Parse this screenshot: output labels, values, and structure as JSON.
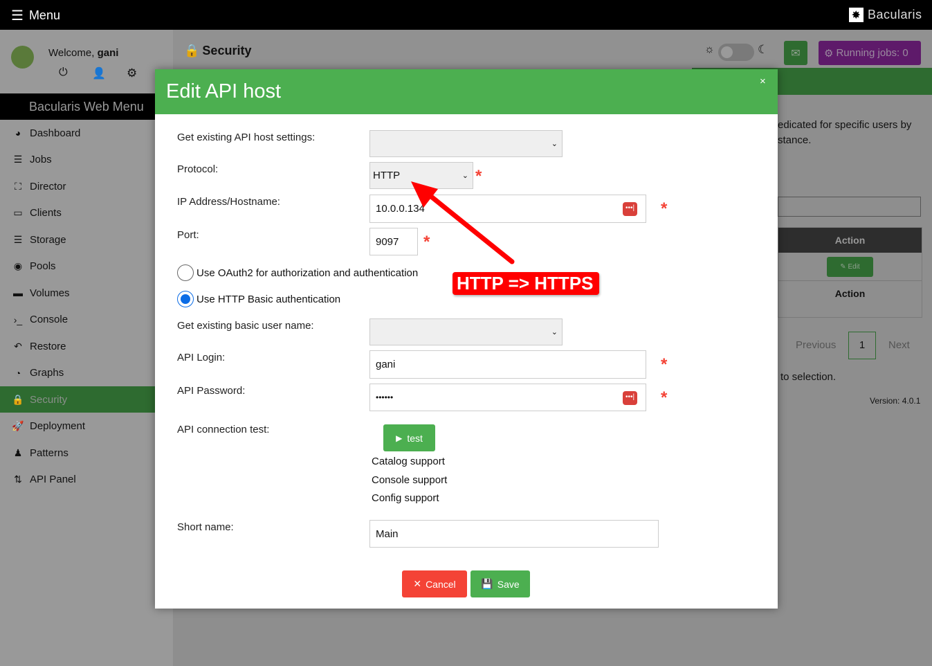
{
  "topbar": {
    "menu_label": "Menu",
    "brand": "Bacularis"
  },
  "user": {
    "welcome": "Welcome,",
    "name": "gani"
  },
  "sidebar": {
    "title": "Bacularis Web Menu",
    "items": [
      {
        "label": "Dashboard",
        "icon": "dashboard-icon"
      },
      {
        "label": "Jobs",
        "icon": "jobs-icon"
      },
      {
        "label": "Director",
        "icon": "director-icon"
      },
      {
        "label": "Clients",
        "icon": "clients-icon"
      },
      {
        "label": "Storage",
        "icon": "storage-icon"
      },
      {
        "label": "Pools",
        "icon": "pools-icon"
      },
      {
        "label": "Volumes",
        "icon": "volumes-icon"
      },
      {
        "label": "Console",
        "icon": "console-icon"
      },
      {
        "label": "Restore",
        "icon": "restore-icon"
      },
      {
        "label": "Graphs",
        "icon": "graphs-icon"
      },
      {
        "label": "Security",
        "icon": "lock-icon",
        "active": true
      },
      {
        "label": "Deployment",
        "icon": "rocket-icon"
      },
      {
        "label": "Patterns",
        "icon": "stamp-icon"
      },
      {
        "label": "API Panel",
        "icon": "arrows-icon"
      }
    ]
  },
  "header": {
    "title": "Security",
    "running_jobs": "Running jobs: 0"
  },
  "background": {
    "text1": "edicated for specific users by",
    "text2": "stance.",
    "col_action": "Action",
    "edit_label": "Edit",
    "col_action_footer": "Action",
    "prev": "Previous",
    "page": "1",
    "next": "Next",
    "selection": "to selection.",
    "version": "Version: 4.0.1"
  },
  "modal": {
    "title": "Edit API host",
    "close": "×",
    "get_existing_label": "Get existing API host settings:",
    "get_existing_value": "",
    "protocol_label": "Protocol:",
    "protocol_value": "HTTP",
    "ip_label": "IP Address/Hostname:",
    "ip_value": "10.0.0.134",
    "port_label": "Port:",
    "port_value": "9097",
    "oauth_label": "Use OAuth2 for authorization and authentication",
    "oauth_checked": false,
    "basic_label": "Use HTTP Basic authentication",
    "basic_checked": true,
    "basic_user_label": "Get existing basic user name:",
    "basic_user_value": "",
    "login_label": "API Login:",
    "login_value": "gani",
    "password_label": "API Password:",
    "password_value": "••••••",
    "test_label": "API connection test:",
    "test_button": "test",
    "support": [
      "Catalog support",
      "Console support",
      "Config support"
    ],
    "short_name_label": "Short name:",
    "short_name_value": "Main",
    "cancel": "Cancel",
    "save": "Save",
    "required": "*"
  },
  "annotation": {
    "text": "HTTP => HTTPS",
    "color": "#ff0000"
  },
  "colors": {
    "accent": "#4caf50",
    "danger": "#f44336",
    "running_jobs": "#5e1a6a"
  }
}
